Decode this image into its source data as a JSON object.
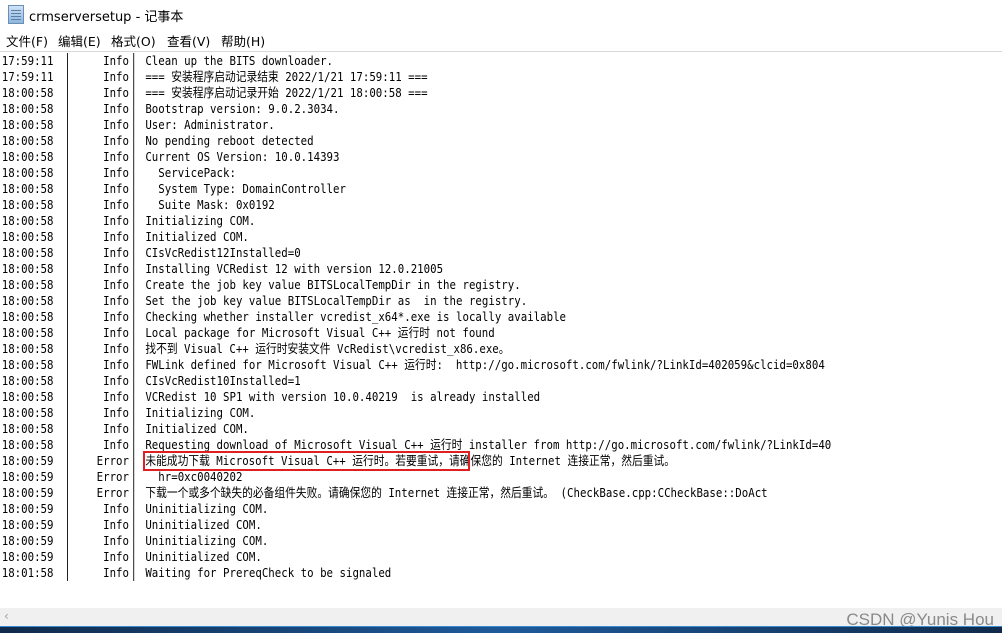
{
  "window": {
    "title": "crmserversetup - 记事本",
    "icon": "notepad-icon"
  },
  "menu": [
    "文件(F)",
    "编辑(E)",
    "格式(O)",
    "查看(V)",
    "帮助(H)"
  ],
  "lines": [
    [
      "17:59:11",
      "Info",
      "Clean up the BITS downloader."
    ],
    [
      "17:59:11",
      "Info",
      "=== 安装程序启动记录结束 2022/1/21 17:59:11 ==="
    ],
    [
      "18:00:58",
      "Info",
      "=== 安装程序启动记录开始 2022/1/21 18:00:58 ==="
    ],
    [
      "18:00:58",
      "Info",
      "Bootstrap version: 9.0.2.3034."
    ],
    [
      "18:00:58",
      "Info",
      "User: Administrator."
    ],
    [
      "18:00:58",
      "Info",
      "No pending reboot detected"
    ],
    [
      "18:00:58",
      "Info",
      "Current OS Version: 10.0.14393"
    ],
    [
      "18:00:58",
      "Info",
      "  ServicePack:"
    ],
    [
      "18:00:58",
      "Info",
      "  System Type: DomainController"
    ],
    [
      "18:00:58",
      "Info",
      "  Suite Mask: 0x0192"
    ],
    [
      "18:00:58",
      "Info",
      "Initializing COM."
    ],
    [
      "18:00:58",
      "Info",
      "Initialized COM."
    ],
    [
      "18:00:58",
      "Info",
      "CIsVcRedist12Installed=0"
    ],
    [
      "18:00:58",
      "Info",
      "Installing VCRedist 12 with version 12.0.21005"
    ],
    [
      "18:00:58",
      "Info",
      "Create the job key value BITSLocalTempDir in the registry."
    ],
    [
      "18:00:58",
      "Info",
      "Set the job key value BITSLocalTempDir as  in the registry."
    ],
    [
      "18:00:58",
      "Info",
      "Checking whether installer vcredist_x64*.exe is locally available"
    ],
    [
      "18:00:58",
      "Info",
      "Local package for Microsoft Visual C++ 运行时 not found"
    ],
    [
      "18:00:58",
      "Info",
      "找不到 Visual C++ 运行时安装文件 VcRedist\\vcredist_x86.exe。"
    ],
    [
      "18:00:58",
      "Info",
      "FWLink defined for Microsoft Visual C++ 运行时:  http://go.microsoft.com/fwlink/?LinkId=402059&clcid=0x804"
    ],
    [
      "18:00:58",
      "Info",
      "CIsVcRedist10Installed=1"
    ],
    [
      "18:00:58",
      "Info",
      "VCRedist 10 SP1 with version 10.0.40219  is already installed"
    ],
    [
      "18:00:58",
      "Info",
      "Initializing COM."
    ],
    [
      "18:00:58",
      "Info",
      "Initialized COM."
    ],
    [
      "18:00:58",
      "Info",
      "Requesting download of Microsoft Visual C++ 运行时 installer from http://go.microsoft.com/fwlink/?LinkId=40"
    ],
    [
      "18:00:59",
      "Error",
      "未能成功下载 Microsoft Visual C++ 运行时。若要重试，请确保您的 Internet 连接正常，然后重试。"
    ],
    [
      "18:00:59",
      "Error",
      "  hr=0xc0040202"
    ],
    [
      "18:00:59",
      "Error",
      "下载一个或多个缺失的必备组件失败。请确保您的 Internet 连接正常，然后重试。 (CheckBase.cpp:CCheckBase::DoAct"
    ],
    [
      "18:00:59",
      "Info",
      "Uninitializing COM."
    ],
    [
      "18:00:59",
      "Info",
      "Uninitialized COM."
    ],
    [
      "18:00:59",
      "Info",
      "Uninitializing COM."
    ],
    [
      "18:00:59",
      "Info",
      "Uninitialized COM."
    ],
    [
      "18:01:58",
      "Info",
      "Waiting for PrereqCheck to be signaled"
    ]
  ],
  "highlight_color": "#e02020",
  "watermark": "CSDN @Yunis Hou"
}
